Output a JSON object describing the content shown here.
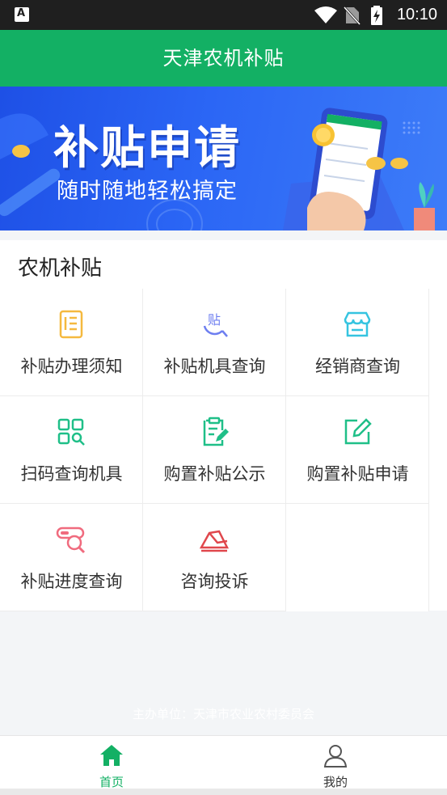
{
  "status_bar": {
    "time": "10:10",
    "icons": [
      "app-a-icon",
      "wifi-icon",
      "no-sim-icon",
      "battery-charging-icon"
    ]
  },
  "app_bar": {
    "title": "天津农机补贴"
  },
  "banner": {
    "headline": "补贴申请",
    "subline": "随时随地轻松搞定"
  },
  "section": {
    "title": "农机补贴",
    "items": [
      {
        "label": "补贴办理须知",
        "icon": "notice-doc-icon",
        "color": "#f5b93f"
      },
      {
        "label": "补贴机具查询",
        "icon": "subsidy-search-icon",
        "color": "#6d7ef0"
      },
      {
        "label": "经销商查询",
        "icon": "store-icon",
        "color": "#35c4e0"
      },
      {
        "label": "扫码查询机具",
        "icon": "scan-grid-icon",
        "color": "#1fbf88"
      },
      {
        "label": "购置补贴公示",
        "icon": "clipboard-edit-icon",
        "color": "#1fbf88"
      },
      {
        "label": "购置补贴申请",
        "icon": "edit-square-icon",
        "color": "#1fbf88"
      },
      {
        "label": "补贴进度查询",
        "icon": "progress-search-icon",
        "color": "#f06b7e"
      },
      {
        "label": "咨询投诉",
        "icon": "complaint-envelope-icon",
        "color": "#e0474c"
      }
    ]
  },
  "footer": {
    "organizer": "主办单位：天津市农业农村委员会"
  },
  "tabs": [
    {
      "label": "首页",
      "icon": "home-icon",
      "active": true,
      "color": "#13b064"
    },
    {
      "label": "我的",
      "icon": "user-icon",
      "active": false,
      "color": "#333333"
    }
  ],
  "colors": {
    "brand": "#13b064",
    "banner": "#2b66f5"
  }
}
